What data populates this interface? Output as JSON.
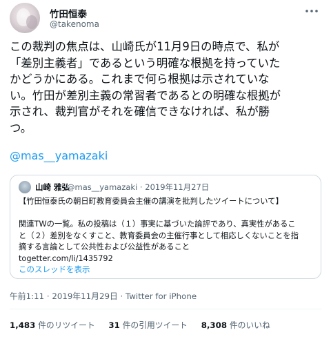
{
  "author": {
    "name": "竹田恒泰",
    "handle": "@takenoma"
  },
  "tweet": {
    "text": "この裁判の焦点は、山崎氏が11月9日の時点で、私が\n「差別主義者」であるという明確な根拠を持っていた\nかどうかにある。これまで何ら根拠は示されていな\nい。竹田が差別主義の常習者であるとの明確な根拠が\n示され、裁判官がそれを確信できなければ、私が勝\nつ。",
    "mention": "@mas__yamazaki",
    "timestamp": "午前1:11 · 2019年11月29日 · Twitter for iPhone"
  },
  "quote": {
    "name": "山崎 雅弘",
    "meta": "@mas__yamazaki · 2019年11月27日",
    "text": "【竹田恒泰氏の朝日町教育委員会主催の講演を批判したツイートについて】\n\n関連TWの一覧。私の投稿は（１）事実に基づいた論評であり、真実性があるこ\nと（２）差別をなくすこと、教育委員会の主催行事として相応しくないことを指\n摘する言論として公共性および公益性があること\ntogetter.com/li/1435792",
    "thread_link": "このスレッドを表示"
  },
  "stats": {
    "retweets_num": "1,483",
    "retweets_label": "件のリツイート",
    "quotes_num": "31",
    "quotes_label": "件の引用ツイート",
    "likes_num": "8,308",
    "likes_label": "件のいいね"
  },
  "colors": {
    "link": "#1d9bf0",
    "secondary_text": "#536471",
    "primary_text": "#0f1419",
    "border": "#cfd9de"
  },
  "icons": {
    "more": "more-horizontal-icon"
  }
}
